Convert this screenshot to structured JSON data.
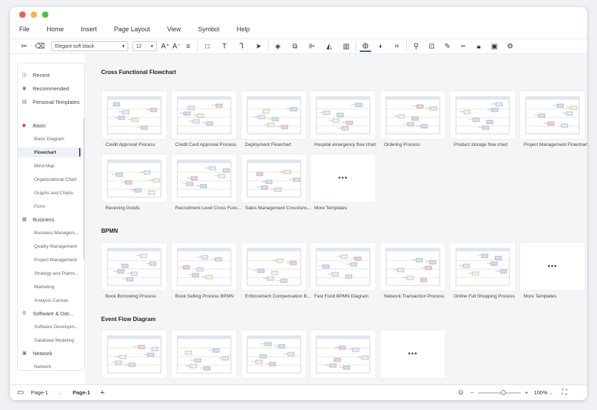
{
  "menu": [
    "File",
    "Home",
    "Insert",
    "Page Layout",
    "View",
    "Symbol",
    "Help"
  ],
  "toolbar": {
    "font": "Elegant soft black",
    "size": "12"
  },
  "sidebar": {
    "top": [
      {
        "label": "Recent",
        "icon": "clock-icon"
      },
      {
        "label": "Recommended",
        "icon": "thumb-icon"
      },
      {
        "label": "Personal Templates",
        "icon": "doc-icon"
      }
    ],
    "basic": {
      "label": "Basic",
      "items": [
        "Basic Diagram",
        "Flowchart",
        "Mind Map",
        "Organizational Chart",
        "Graphs and Charts",
        "Form"
      ]
    },
    "business": {
      "label": "Business",
      "items": [
        "Business Managem...",
        "Quality Management",
        "Project Management",
        "Strategy and Planni...",
        "Marketing",
        "Analysis Canvas"
      ]
    },
    "software": {
      "label": "Software & Dat...",
      "items": [
        "Software Developm...",
        "Database Modeling"
      ]
    },
    "network": {
      "label": "Network",
      "items": [
        "Network"
      ]
    }
  },
  "sections": [
    {
      "title": "Cross Functional Flowchart",
      "cards": [
        "Credit Approval Process",
        "Credit Card Approval Process",
        "Deployment Flowchart",
        "Hospital emergency flow chart",
        "Ordering Process",
        "Product storage flow chart",
        "Project Management Flowchart",
        "Receving Goods",
        "Recruitment Level Cross Func...",
        "Sales Management Crossfunc...",
        "More Templates"
      ]
    },
    {
      "title": "BPMN",
      "cards": [
        "Book Borrowing Process",
        "Book Selling Process BPMN",
        "Enforcement Compensation B...",
        "Fast Food BPMN Diagram",
        "Network Transaction Process",
        "Online Full Shopping Process",
        "More Templates"
      ]
    },
    {
      "title": "Event Flow Diagram",
      "cards": [
        "",
        "",
        "",
        "",
        ""
      ]
    }
  ],
  "status": {
    "page_tab": "Page-1",
    "active_page": "Page-1",
    "zoom": "100%"
  },
  "colors": {
    "accent": "#2e5fa8"
  }
}
